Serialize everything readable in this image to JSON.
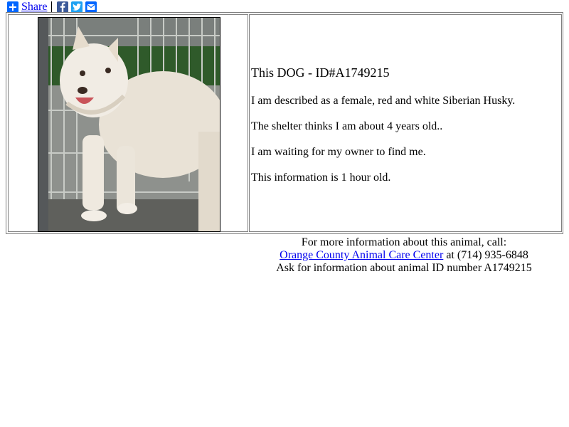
{
  "share": {
    "label": "Share",
    "icons": [
      "share-plus-icon",
      "facebook-icon",
      "twitter-icon",
      "email-icon"
    ]
  },
  "animal": {
    "title": "This DOG - ID#A1749215",
    "description": "I am described as a female, red and white Siberian Husky.",
    "age": "The shelter thinks I am about 4 years old..",
    "status": "I am waiting for my owner to find me.",
    "freshness": "This information is 1 hour old."
  },
  "footer": {
    "line1": "For more information about this animal, call:",
    "shelter_name": "Orange County Animal Care Center",
    "phone_text": " at (714) 935-6848",
    "line3": "Ask for information about animal ID number A1749215"
  },
  "colors": {
    "link": "#0000ee",
    "share_blue": "#0166ff",
    "facebook_blue": "#3b5998",
    "twitter_blue": "#1da1f2"
  }
}
